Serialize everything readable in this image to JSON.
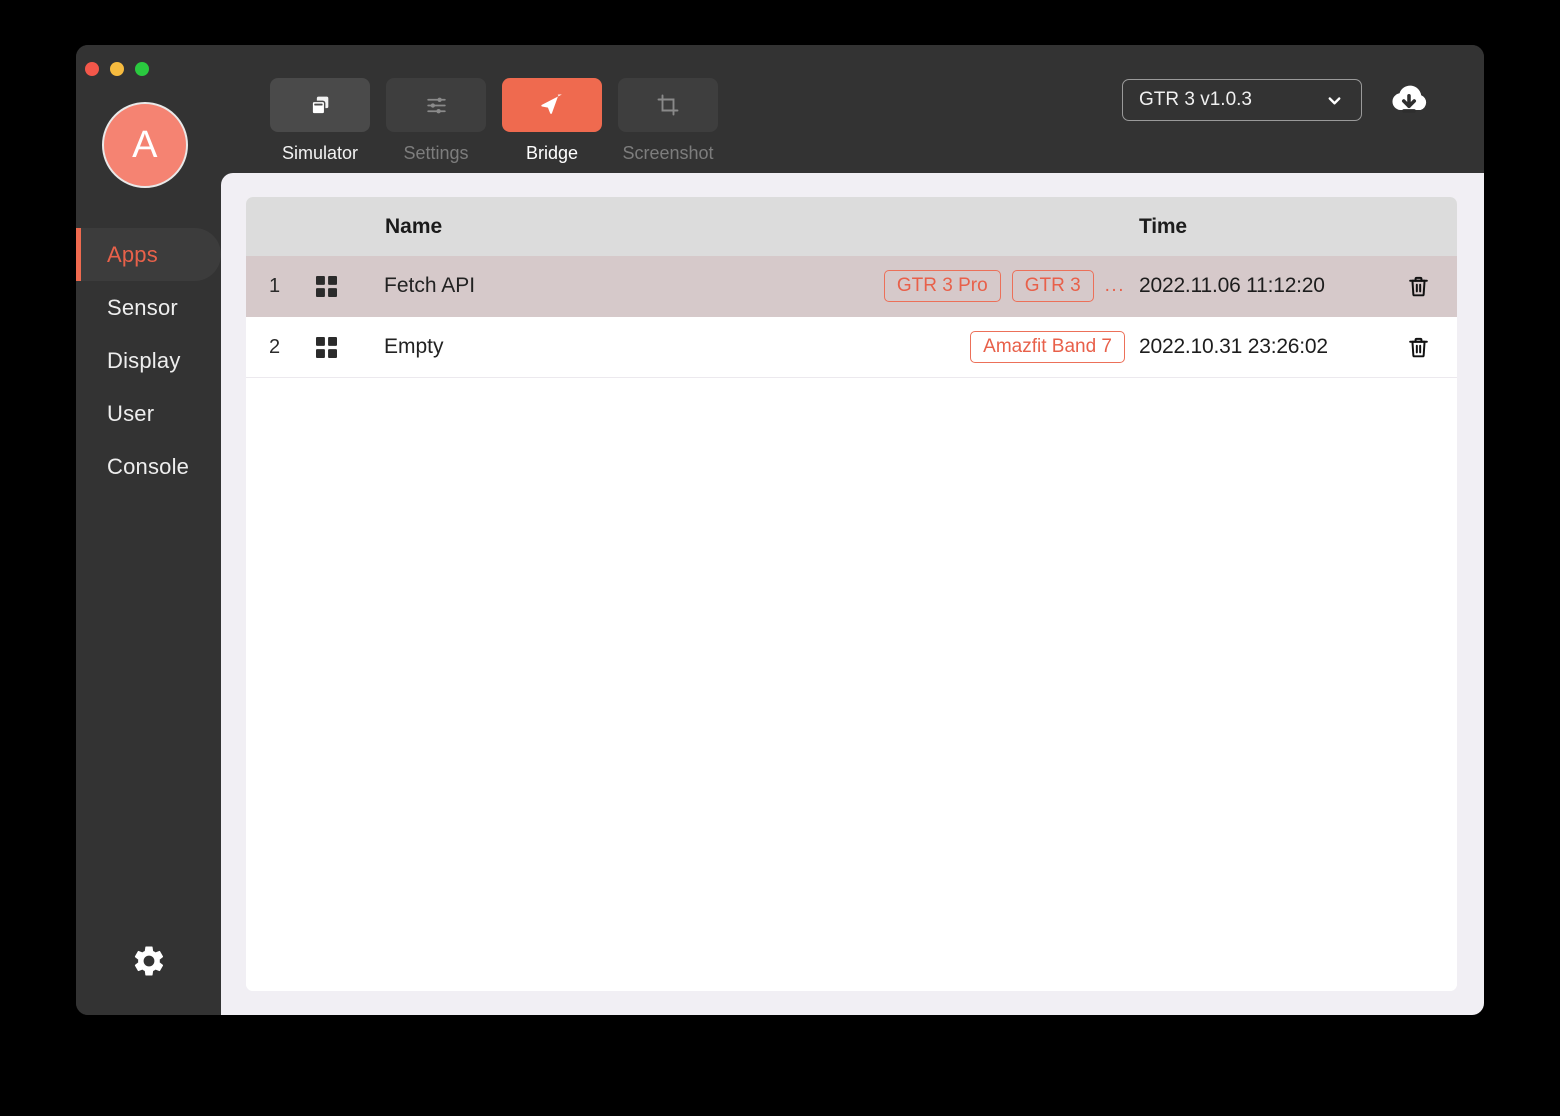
{
  "window": {
    "traffic_lights": [
      "close",
      "minimize",
      "maximize"
    ]
  },
  "sidebar": {
    "avatar_letter": "A",
    "items": [
      {
        "label": "Apps",
        "active": true
      },
      {
        "label": "Sensor",
        "active": false
      },
      {
        "label": "Display",
        "active": false
      },
      {
        "label": "User",
        "active": false
      },
      {
        "label": "Console",
        "active": false
      }
    ],
    "footer": {
      "settings_icon": "gear-icon"
    }
  },
  "toolbar": {
    "tools": [
      {
        "label": "Simulator",
        "icon": "windows-stack-icon",
        "state": "normal"
      },
      {
        "label": "Settings",
        "icon": "sliders-icon",
        "state": "disabled"
      },
      {
        "label": "Bridge",
        "icon": "send-paper-plane-icon",
        "state": "active"
      },
      {
        "label": "Screenshot",
        "icon": "crop-icon",
        "state": "disabled"
      }
    ],
    "device_select": {
      "value": "GTR 3 v1.0.3",
      "chevron_icon": "chevron-down-icon"
    },
    "download_icon": "cloud-download-icon"
  },
  "table": {
    "columns": {
      "index": "",
      "icon": "",
      "name": "Name",
      "tags": "",
      "time": "Time",
      "delete": ""
    },
    "rows": [
      {
        "index": "1",
        "icon": "grid-icon",
        "name": "Fetch API",
        "tags": [
          "GTR 3 Pro",
          "GTR 3"
        ],
        "tags_overflow": "...",
        "time": "2022.11.06 11:12:20",
        "delete_icon": "trash-icon",
        "selected": true
      },
      {
        "index": "2",
        "icon": "grid-icon",
        "name": "Empty",
        "tags": [
          "Amazfit Band 7"
        ],
        "tags_overflow": "",
        "time": "2022.10.31 23:26:02",
        "delete_icon": "trash-icon",
        "selected": false
      }
    ]
  },
  "colors": {
    "accent": "#ef6a4f",
    "tag_border": "#ec7059",
    "tag_text": "#e8604a",
    "window_bg": "#333333",
    "panel_bg": "#f1eff4",
    "table_header_bg": "#dcdcdc",
    "row_selected_bg": "#d6c9ca"
  }
}
